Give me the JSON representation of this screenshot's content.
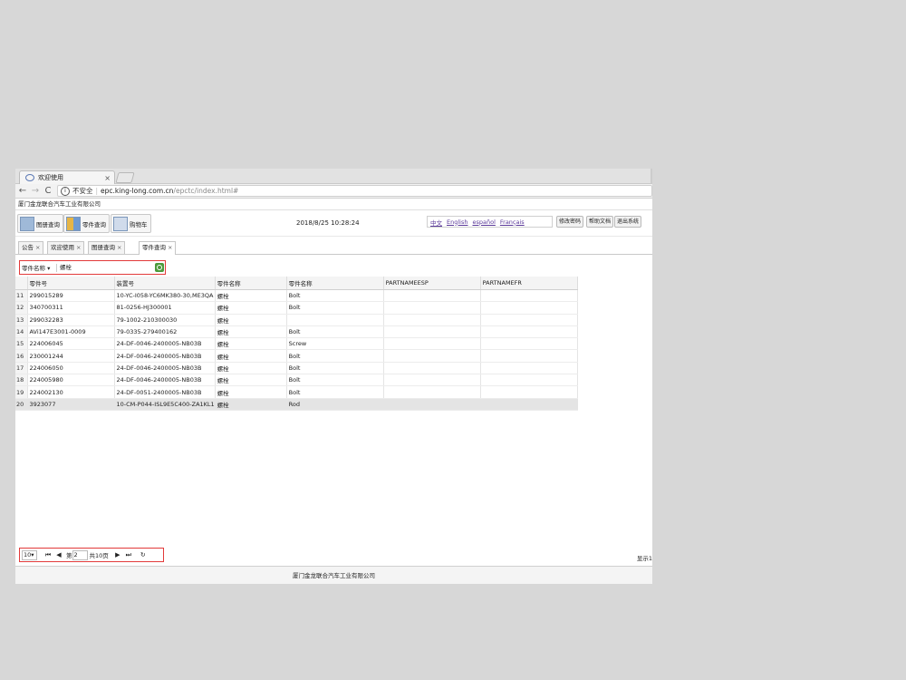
{
  "browser": {
    "tab_title": "欢迎使用",
    "tab_close": "×",
    "nav_back": "←",
    "nav_forward": "→",
    "nav_reload": "C",
    "security_label": "不安全",
    "url_host": "epc.king-long.com.cn",
    "url_path": "/epctc/index.html#"
  },
  "header": {
    "company": "厦门金龙联合汽车工业有限公司",
    "buttons": {
      "catalog": "图册查询",
      "parts": "零件查询",
      "cart": "购物车"
    },
    "datetime": "2018/8/25 10:28:24",
    "languages": [
      "中文",
      "English",
      "español",
      "Français"
    ],
    "actions": {
      "change_password": "修改密码",
      "help": "帮助文档",
      "logout": "退出系统"
    }
  },
  "page_tabs": [
    {
      "label": "公告",
      "close": "×"
    },
    {
      "label": "欢迎使用",
      "close": "×"
    },
    {
      "label": "图册查询",
      "close": "×"
    },
    {
      "label": "零件查询",
      "close": "×"
    }
  ],
  "filter": {
    "field": "零件名称",
    "value": "螺栓"
  },
  "table": {
    "columns": [
      "零件号",
      "装置号",
      "零件名称",
      "零件名称",
      "PARTNAMEESP",
      "PARTNAMEFR"
    ],
    "rows": [
      [
        "11",
        "299015289",
        "10-YC-I058-YC6MK380-30,ME3QA",
        "螺栓",
        "Bolt",
        "",
        ""
      ],
      [
        "12",
        "340700311",
        "81-0256-HJ300001",
        "螺栓",
        "Bolt",
        "",
        ""
      ],
      [
        "13",
        "299032283",
        "79-1002-210300030",
        "螺栓",
        "",
        "",
        ""
      ],
      [
        "14",
        "AVi147E3001-0009",
        "79-0335-279400162",
        "螺栓",
        "Bolt",
        "",
        ""
      ],
      [
        "15",
        "224006045",
        "24-DF-0046-2400005-NB03B",
        "螺栓",
        "Screw",
        "",
        ""
      ],
      [
        "16",
        "230001244",
        "24-DF-0046-2400005-NB03B",
        "螺栓",
        "Bolt",
        "",
        ""
      ],
      [
        "17",
        "224006050",
        "24-DF-0046-2400005-NB03B",
        "螺栓",
        "Bolt",
        "",
        ""
      ],
      [
        "18",
        "224005980",
        "24-DF-0046-2400005-NB03B",
        "螺栓",
        "Bolt",
        "",
        ""
      ],
      [
        "19",
        "224002130",
        "24-DF-0051-2400005-NB03B",
        "螺栓",
        "Bolt",
        "",
        ""
      ],
      [
        "20",
        "3923077",
        "10-CM-P044-ISL9E5C400-ZA1KL1",
        "螺栓",
        "Rod",
        "",
        ""
      ]
    ],
    "selected_row": 9
  },
  "pager": {
    "page_size": "10",
    "page_prefix": "第",
    "current_page": "2",
    "total_text": "共10页",
    "display_text": "显示1"
  },
  "footer": {
    "text": "厦门金龙联合汽车工业有限公司"
  },
  "colors": {
    "highlight_border": "#e23a3a",
    "link": "#5b3a9a"
  }
}
